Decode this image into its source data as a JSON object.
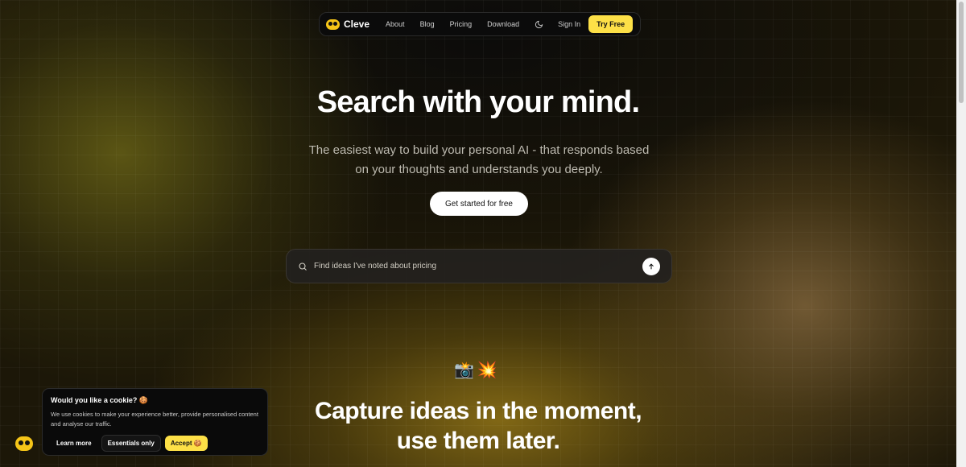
{
  "nav": {
    "brand": "Cleve",
    "links": [
      "About",
      "Blog",
      "Pricing",
      "Download"
    ],
    "theme_icon": "moon-icon",
    "sign_in": "Sign In",
    "try_free": "Try Free"
  },
  "hero": {
    "title": "Search with your mind.",
    "subtitle": "The easiest way to build your personal AI - that responds based on your thoughts and understands you deeply.",
    "cta": "Get started for free"
  },
  "search": {
    "placeholder": "Find ideas I've noted about pricing",
    "icon": "search-icon",
    "submit_icon": "arrow-up-icon"
  },
  "section": {
    "emojis": [
      "📸",
      "💥"
    ],
    "title_line1": "Capture ideas in the moment,",
    "title_line2": "use them later."
  },
  "cookie": {
    "title": "Would you like a cookie? 🍪",
    "body": "We use cookies to make your experience better, provide personalised content and analyse our traffic.",
    "learn_more": "Learn more",
    "essentials": "Essentials only",
    "accept": "Accept 🍪"
  },
  "colors": {
    "accent": "#fde047",
    "background": "#1c1708",
    "nav_bg": "#0b0b0b"
  }
}
